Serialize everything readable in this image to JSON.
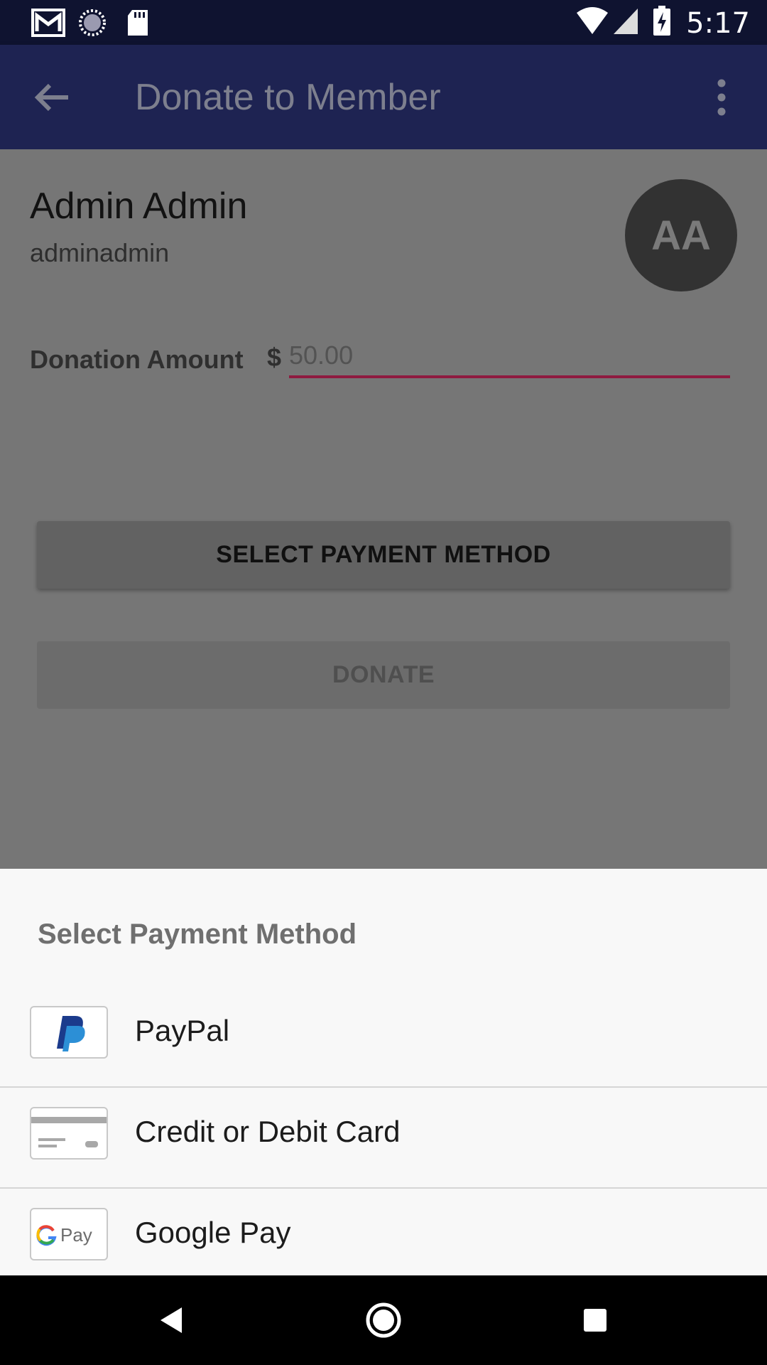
{
  "status_bar": {
    "time": "5:17",
    "icons_left": [
      "gmail-icon",
      "sync-icon",
      "sd-card-icon"
    ],
    "icons_right": [
      "wifi-icon",
      "signal-icon",
      "battery-charging-icon"
    ]
  },
  "app_bar": {
    "title": "Donate to Member",
    "back_icon": "arrow-back-icon",
    "menu_icon": "more-vert-icon"
  },
  "member": {
    "name": "Admin Admin",
    "username": "adminadmin",
    "avatar_initials": "AA"
  },
  "donation": {
    "label": "Donation Amount",
    "currency_symbol": "$",
    "placeholder": "50.00",
    "value": ""
  },
  "buttons": {
    "select_payment": "SELECT PAYMENT METHOD",
    "donate": "DONATE"
  },
  "payment_sheet": {
    "title": "Select Payment Method",
    "options": [
      {
        "label": "PayPal",
        "icon": "paypal-logo-icon"
      },
      {
        "label": "Credit or Debit Card",
        "icon": "credit-card-icon"
      },
      {
        "label": "Google Pay",
        "icon": "google-pay-logo-icon",
        "logo_text": "Pay"
      }
    ]
  },
  "nav_bar": {
    "buttons": [
      "back-triangle-icon",
      "home-circle-icon",
      "recents-square-icon"
    ]
  },
  "colors": {
    "status_bar": "#0f1330",
    "app_bar": "#1e2352",
    "scrim": "#767676",
    "input_underline": "#8f1a40",
    "sheet": "#f8f8f8"
  }
}
